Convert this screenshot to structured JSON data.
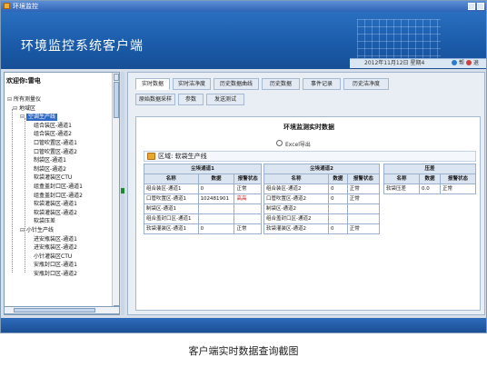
{
  "window": {
    "title": "环境监控"
  },
  "banner": {
    "title": "环境监控系统客户端",
    "datetime": "2012年11月12日 星期4",
    "btn1": "帮",
    "btn2": "退"
  },
  "sidebar": {
    "welcome": "欢迎你:雷电",
    "tree": [
      {
        "label": "所有测量仪",
        "level": 0
      },
      {
        "label": "地域区",
        "level": 1
      },
      {
        "label": "空调生产线",
        "level": 2,
        "selected": true
      },
      {
        "label": "组合装区-通道1",
        "level": 3
      },
      {
        "label": "组合装区-通道2",
        "level": 3
      },
      {
        "label": "口管吹置区-通道1",
        "level": 3
      },
      {
        "label": "口管吹置区-通道2",
        "level": 3
      },
      {
        "label": "制袋区-通道1",
        "level": 3
      },
      {
        "label": "制袋区-通道2",
        "level": 3
      },
      {
        "label": "软袋灌装区CTU",
        "level": 3
      },
      {
        "label": "组盒盖封口区-通道1",
        "level": 3
      },
      {
        "label": "组盒盖封口区-通道2",
        "level": 3
      },
      {
        "label": "软袋灌装区-通道1",
        "level": 3
      },
      {
        "label": "软袋灌装区-通道2",
        "level": 3
      },
      {
        "label": "软袋压差",
        "level": 3
      },
      {
        "label": "小针生产线",
        "level": 2
      },
      {
        "label": "进安瓶装区-通道1",
        "level": 3
      },
      {
        "label": "进安瓶装区-通道2",
        "level": 3
      },
      {
        "label": "小针灌装区CTU",
        "level": 3
      },
      {
        "label": "安瓶封口区-通道1",
        "level": 3
      },
      {
        "label": "安瓶封口区-通道2",
        "level": 3
      }
    ]
  },
  "tabs": [
    {
      "label": "实时数据",
      "active": true
    },
    {
      "label": "实时洁净度"
    },
    {
      "label": "历史数据曲线"
    },
    {
      "label": "历史数据"
    },
    {
      "label": "事件记录"
    },
    {
      "label": "历史洁净度"
    },
    {
      "label": "原始数据采样"
    },
    {
      "label": "参数"
    },
    {
      "label": "发送测试"
    }
  ],
  "content": {
    "title": "环境监测实时数据",
    "export_label": "Excel导出",
    "region_label": "区域: 软袋生产线"
  },
  "table1": {
    "group": "尘埃通道1",
    "headers": [
      "名称",
      "数据",
      "报警状态"
    ],
    "rows": [
      [
        "组合装区-通道1",
        "0",
        "正常"
      ],
      [
        "口管吹置区-通道1",
        "102481901",
        "高高"
      ],
      [
        "制袋区-通道1",
        "",
        ""
      ],
      [
        "组合盖封口区-通道1",
        "",
        ""
      ],
      [
        "软袋灌装区-通道1",
        "0",
        "正常"
      ]
    ]
  },
  "table2": {
    "group": "尘埃通道2",
    "headers": [
      "名称",
      "数据",
      "报警状态"
    ],
    "rows": [
      [
        "组合装区-通道2",
        "0",
        "正常"
      ],
      [
        "口管吹置区-通道2",
        "0",
        "正常"
      ],
      [
        "制袋区-通道2",
        "",
        ""
      ],
      [
        "组合盖封口区-通道2",
        "",
        ""
      ],
      [
        "软袋灌装区-通道2",
        "0",
        "正常"
      ]
    ]
  },
  "table3": {
    "group": "压差",
    "headers": [
      "名称",
      "数据",
      "报警状态"
    ],
    "rows": [
      [
        "软袋压差",
        "0.0",
        "正常"
      ]
    ]
  },
  "caption": "客户端实时数据查询截图",
  "colors": {
    "banner": "#1a5aa8",
    "alarm": "#d01010",
    "selected": "#316ac5"
  }
}
